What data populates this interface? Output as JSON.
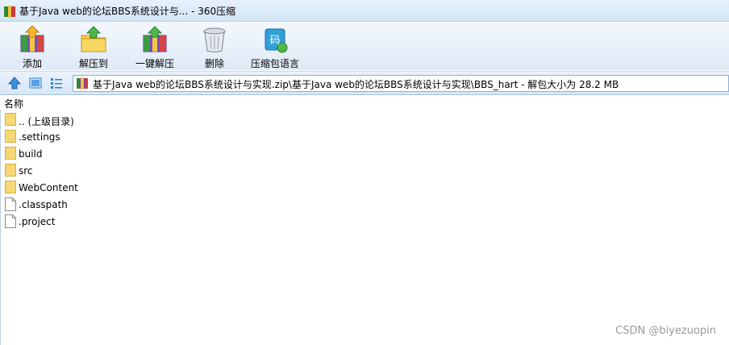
{
  "window": {
    "title": "基于Java web的论坛BBS系统设计与... - 360压缩"
  },
  "toolbar": {
    "add": "添加",
    "extract_to": "解压到",
    "one_click_extract": "一键解压",
    "delete": "删除",
    "archive_language": "压缩包语言",
    "language_icon_glyph": "码"
  },
  "address": {
    "path": "基于Java web的论坛BBS系统设计与实现.zip\\基于Java web的论坛BBS系统设计与实现\\BBS_hart - 解包大小为 28.2 MB"
  },
  "columns": {
    "name": "名称"
  },
  "files": [
    {
      "name": ".. (上级目录)",
      "type": "folder"
    },
    {
      "name": ".settings",
      "type": "folder"
    },
    {
      "name": "build",
      "type": "folder"
    },
    {
      "name": "src",
      "type": "folder"
    },
    {
      "name": "WebContent",
      "type": "folder"
    },
    {
      "name": ".classpath",
      "type": "file"
    },
    {
      "name": ".project",
      "type": "file"
    }
  ],
  "watermark": "CSDN @biyezuopin",
  "colors": {
    "folder": "#f7d774",
    "accent": "#2f7fd3"
  }
}
